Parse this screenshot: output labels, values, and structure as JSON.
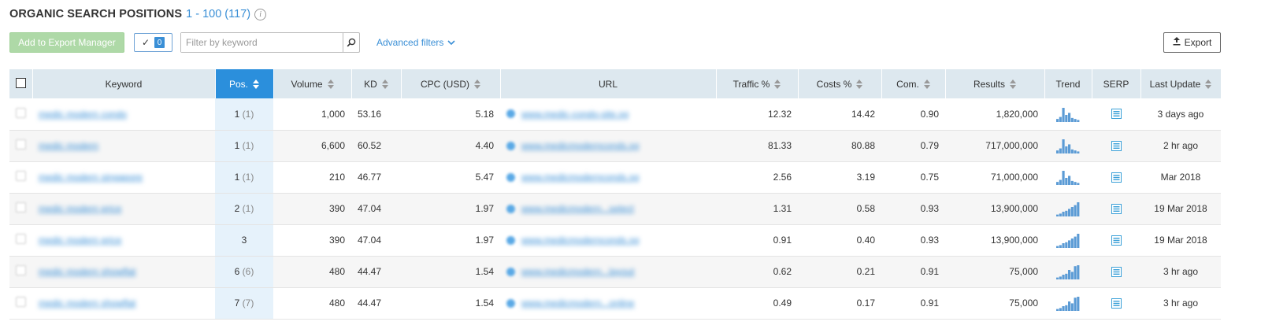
{
  "header": {
    "title": "ORGANIC SEARCH POSITIONS",
    "range": "1 - 100 (117)",
    "info_glyph": "i"
  },
  "toolbar": {
    "add_export_label": "Add to Export Manager",
    "selected_count": "0",
    "filter_placeholder": "Filter by keyword",
    "advanced_filters_label": "Advanced filters",
    "export_label": "Export"
  },
  "table": {
    "columns": {
      "keyword": "Keyword",
      "pos": "Pos.",
      "volume": "Volume",
      "kd": "KD",
      "cpc": "CPC (USD)",
      "url": "URL",
      "traffic": "Traffic %",
      "costs": "Costs %",
      "com": "Com.",
      "results": "Results",
      "trend": "Trend",
      "serp": "SERP",
      "last_update": "Last Update"
    },
    "rows": [
      {
        "keyword": "medic modern condo",
        "pos": "1",
        "pos_prev": "(1)",
        "volume": "1,000",
        "kd": "53.16",
        "cpc": "5.18",
        "url": "www.medic-condo-site.sg",
        "traffic": "12.32",
        "costs": "14.42",
        "com": "0.90",
        "results": "1,820,000",
        "trend": [
          3,
          5,
          14,
          7,
          9,
          4,
          3,
          2
        ],
        "last_update": "3 days ago"
      },
      {
        "keyword": "medic modern",
        "pos": "1",
        "pos_prev": "(1)",
        "volume": "6,600",
        "kd": "60.52",
        "cpc": "4.40",
        "url": "www.medicmodernconds.sg",
        "traffic": "81.33",
        "costs": "80.88",
        "com": "0.79",
        "results": "717,000,000",
        "trend": [
          3,
          5,
          14,
          7,
          9,
          4,
          3,
          2
        ],
        "last_update": "2 hr ago"
      },
      {
        "keyword": "medic modern singapore",
        "pos": "1",
        "pos_prev": "(1)",
        "volume": "210",
        "kd": "46.77",
        "cpc": "5.47",
        "url": "www.medicmodernconds.sg",
        "traffic": "2.56",
        "costs": "3.19",
        "com": "0.75",
        "results": "71,000,000",
        "trend": [
          3,
          5,
          14,
          7,
          9,
          4,
          3,
          2
        ],
        "last_update": "Mar 2018"
      },
      {
        "keyword": "medic modern price",
        "pos": "2",
        "pos_prev": "(1)",
        "volume": "390",
        "kd": "47.04",
        "cpc": "1.97",
        "url": "www.medicmodern...select",
        "traffic": "1.31",
        "costs": "0.58",
        "com": "0.93",
        "results": "13,900,000",
        "trend": [
          2,
          3,
          5,
          6,
          8,
          10,
          12,
          15
        ],
        "last_update": "19 Mar 2018"
      },
      {
        "keyword": "medic modern price",
        "pos": "3",
        "pos_prev": "",
        "volume": "390",
        "kd": "47.04",
        "cpc": "1.97",
        "url": "www.medicmodernconds.sg",
        "traffic": "0.91",
        "costs": "0.40",
        "com": "0.93",
        "results": "13,900,000",
        "trend": [
          2,
          3,
          5,
          6,
          8,
          10,
          12,
          15
        ],
        "last_update": "19 Mar 2018"
      },
      {
        "keyword": "medic modern showflat",
        "pos": "6",
        "pos_prev": "(6)",
        "volume": "480",
        "kd": "44.47",
        "cpc": "1.54",
        "url": "www.medicmodern...layout",
        "traffic": "0.62",
        "costs": "0.21",
        "com": "0.91",
        "results": "75,000",
        "trend": [
          2,
          3,
          5,
          6,
          10,
          8,
          14,
          15
        ],
        "last_update": "3 hr ago"
      },
      {
        "keyword": "medic modern showflat",
        "pos": "7",
        "pos_prev": "(7)",
        "volume": "480",
        "kd": "44.47",
        "cpc": "1.54",
        "url": "www.medicmodern...online",
        "traffic": "0.49",
        "costs": "0.17",
        "com": "0.91",
        "results": "75,000",
        "trend": [
          2,
          3,
          5,
          6,
          10,
          8,
          14,
          15
        ],
        "last_update": "3 hr ago"
      }
    ]
  },
  "colors": {
    "accent": "#2b8fdc",
    "link": "#3a8fd6",
    "header_bg": "#dde8ef",
    "sorted_col_bg": "#e6f2fb",
    "export_btn": "#aed9a7",
    "trend_bar": "#5b9bd5",
    "serp_icon": "#3aa0d8"
  }
}
